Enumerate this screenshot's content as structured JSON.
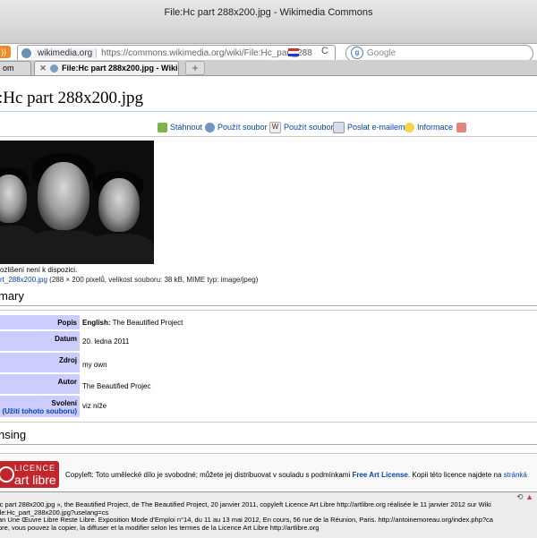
{
  "window": {
    "title": "File:Hc part 288x200.jpg - Wikimedia Commons"
  },
  "addressbar": {
    "site": "wikimedia.org",
    "url": "https://commons.wikimedia.org/wiki/File:Hc_part_288",
    "search_placeholder": "Google"
  },
  "tabs": [
    {
      "label": "om"
    },
    {
      "label": "File:Hc part 288x200.jpg - Wiki..."
    }
  ],
  "page": {
    "title": ":Hc part 288x200.jpg"
  },
  "toolbar": {
    "download": "Stáhnout",
    "use_file": "Použít soubor",
    "use_wiki": "Použít soubor",
    "email": "Poslat e-mailem",
    "info": "Informace"
  },
  "image": {
    "note": "ozlišení není k dispozici.",
    "file_link": "rt_288x200.jpg",
    "file_meta": " (288 × 200 pixelů, velikost souboru: 38 kB, MIME typ: image/jpeg)"
  },
  "summary": {
    "heading": "mary",
    "rows": [
      {
        "label": "Popis",
        "value_bold": "English:",
        "value": " The Beautified Project"
      },
      {
        "label": "Datum",
        "value": "20. ledna 2011"
      },
      {
        "label": "Zdroj",
        "value": "my own"
      },
      {
        "label": "Autor",
        "value": "The Beautified Projec"
      },
      {
        "label": "Svolení",
        "label_sub": "(Užití tohoto souboru)",
        "value": "viz níže"
      }
    ]
  },
  "licensing": {
    "heading": "nsing",
    "logo_line1": "LICENCE",
    "logo_line2": "art libre",
    "text": "Copyleft: Toto umělecké dílo je svobodné; můžete jej distribuovat v souladu s podmínkami ",
    "link": "Free Art License",
    "tail": ". Kopii této licence najdete na ",
    "tail_link": "stránká"
  },
  "status": {
    "lines": [
      "lc part 288x200.jpg », the Beautified Project, de The Beautified Project, 20 janvier 2011, copyleft Licence Art Libre http://artlibre.org réalisée le 11 janvier 2012 sur Wiki",
      "ile:Hc_part_288x200.jpg?uselang=cs",
      "an Une Œuvre Libre Reste Libre. Exposition Mode d'Emploi n°14, du 11 au 13 mai 2012, En cours, 56 rue de la Réunion, Paris. http://antoinemoreau.org/index.php?ca",
      "bre, vous pouvez la copier, la diffuser et la modifier selon les termes de la Licence Art Libre http://artlibre.org"
    ]
  }
}
